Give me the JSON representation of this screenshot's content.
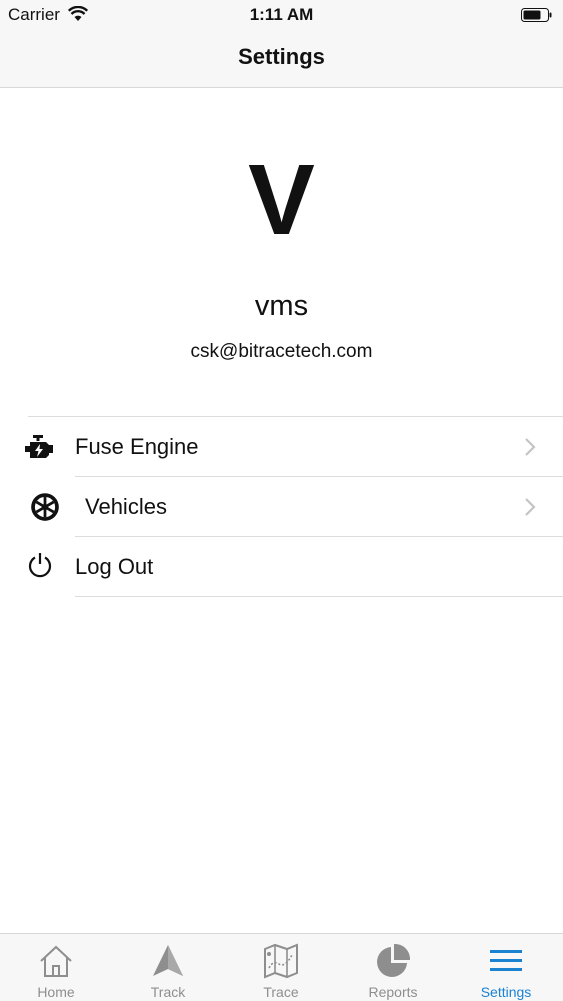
{
  "status_bar": {
    "carrier": "Carrier",
    "time": "1:11 AM"
  },
  "nav": {
    "title": "Settings"
  },
  "profile": {
    "initial": "V",
    "name": "vms",
    "email": "csk@bitracetech.com"
  },
  "menu": {
    "items": [
      {
        "label": "Fuse Engine",
        "icon": "engine-icon",
        "has_chevron": true
      },
      {
        "label": "Vehicles",
        "icon": "wheel-icon",
        "has_chevron": true
      },
      {
        "label": "Log Out",
        "icon": "power-icon",
        "has_chevron": false
      }
    ]
  },
  "tabs": {
    "items": [
      {
        "label": "Home",
        "icon": "home-icon",
        "active": false
      },
      {
        "label": "Track",
        "icon": "navigation-arrow-icon",
        "active": false
      },
      {
        "label": "Trace",
        "icon": "map-icon",
        "active": false
      },
      {
        "label": "Reports",
        "icon": "pie-chart-icon",
        "active": false
      },
      {
        "label": "Settings",
        "icon": "menu-lines-icon",
        "active": true
      }
    ]
  },
  "colors": {
    "accent": "#1b82d2",
    "inactive": "#8e8e8e",
    "bar_bg": "#f7f7f7",
    "separator": "#dcdcdc"
  }
}
